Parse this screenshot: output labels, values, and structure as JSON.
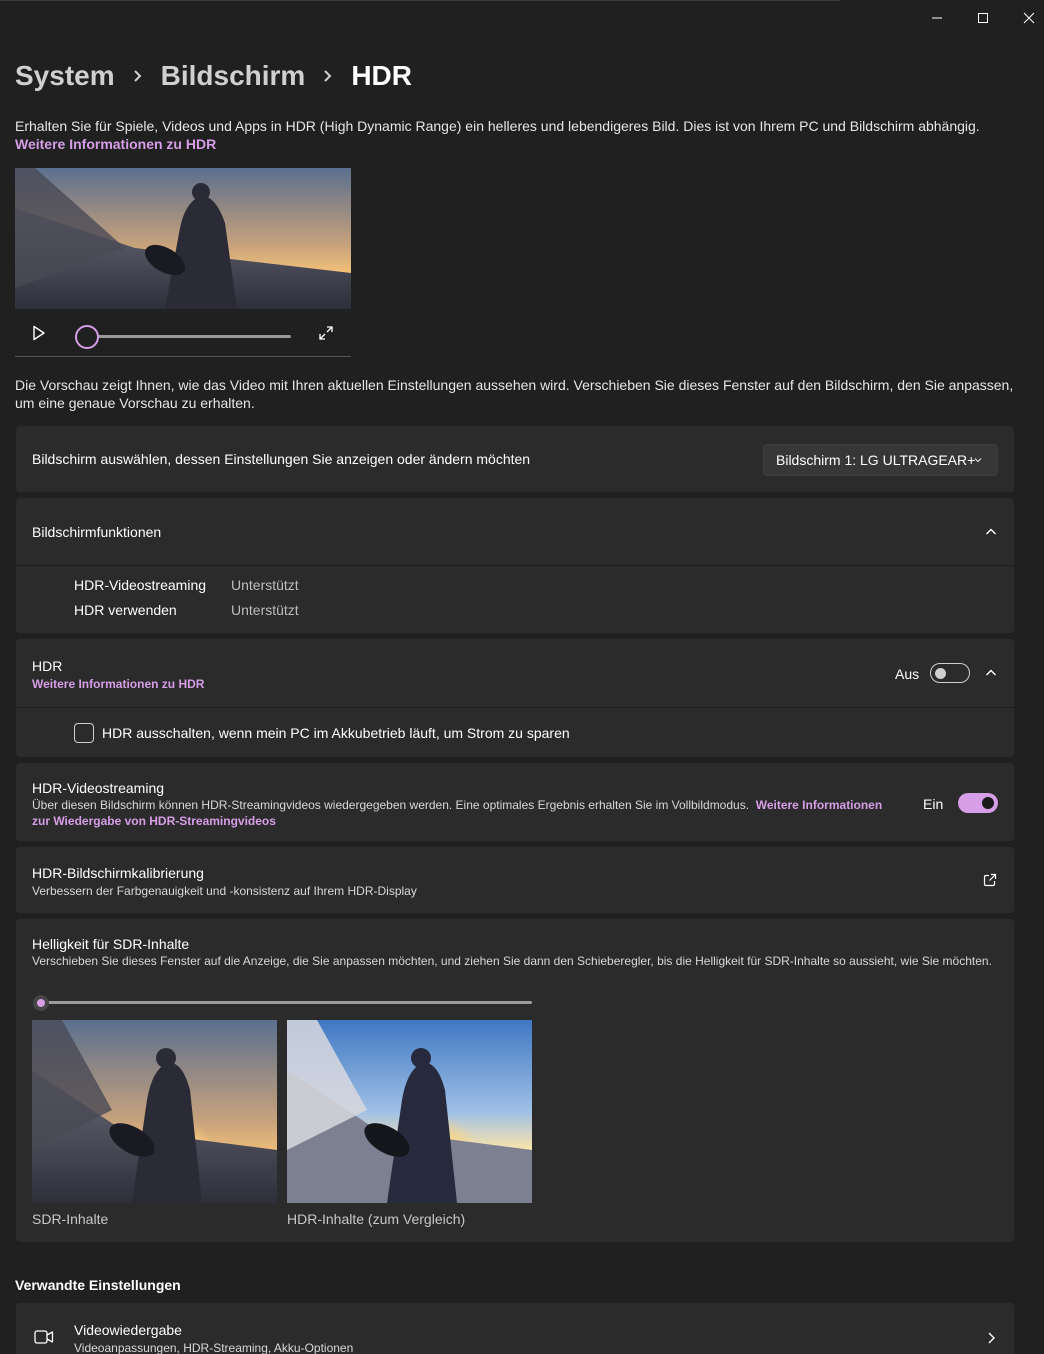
{
  "window": {
    "minimize_icon": "minimize-icon",
    "maximize_icon": "maximize-icon",
    "close_icon": "close-icon"
  },
  "breadcrumb": [
    "System",
    "Bildschirm",
    "HDR"
  ],
  "intro": {
    "text": "Erhalten Sie für Spiele, Videos und Apps in HDR (High Dynamic Range) ein helleres und lebendigeres Bild. Dies ist von Ihrem PC und Bildschirm abhängig.",
    "link": "Weitere Informationen zu HDR"
  },
  "video": {
    "play_icon": "play-icon",
    "fullscreen_icon": "fullscreen-icon",
    "progress": 0
  },
  "preview_note": "Die Vorschau zeigt Ihnen, wie das Video mit Ihren aktuellen Einstellungen aussehen wird. Verschieben Sie dieses Fenster auf den Bildschirm, den Sie anpassen, um eine genaue Vorschau zu erhalten.",
  "display_select": {
    "label": "Bildschirm auswählen, dessen Einstellungen Sie anzeigen oder ändern möchten",
    "value": "Bildschirm 1: LG ULTRAGEAR+"
  },
  "capabilities": {
    "title": "Bildschirmfunktionen",
    "rows": [
      {
        "name": "HDR-Videostreaming",
        "value": "Unterstützt"
      },
      {
        "name": "HDR verwenden",
        "value": "Unterstützt"
      }
    ]
  },
  "hdr": {
    "title": "HDR",
    "link": "Weitere Informationen zu HDR",
    "state": "Aus",
    "enabled": false,
    "battery_option": "HDR ausschalten, wenn mein PC im Akkubetrieb läuft, um Strom zu sparen",
    "battery_checked": false
  },
  "streaming": {
    "title": "HDR-Videostreaming",
    "desc": "Über diesen Bildschirm können HDR-Streamingvideos wiedergegeben werden. Eine optimales Ergebnis erhalten Sie im Vollbildmodus.",
    "link_a": "Weitere Informationen",
    "link_b": "zur Wiedergabe von HDR-Streamingvideos",
    "state": "Ein",
    "enabled": true
  },
  "calibration": {
    "title": "HDR-Bildschirmkalibrierung",
    "desc": "Verbessern der Farbgenauigkeit und -konsistenz auf Ihrem HDR-Display",
    "icon": "external-link-icon"
  },
  "sdr_brightness": {
    "title": "Helligkeit für SDR-Inhalte",
    "desc": "Verschieben Sie dieses Fenster auf die Anzeige, die Sie anpassen möchten, und ziehen Sie dann den Schieberegler, bis die Helligkeit für SDR-Inhalte so aussieht, wie Sie möchten.",
    "value": 0,
    "sdr_caption": "SDR-Inhalte",
    "hdr_caption": "HDR-Inhalte (zum Vergleich)"
  },
  "related": {
    "title": "Verwandte Einstellungen",
    "items": [
      {
        "title": "Videowiedergabe",
        "desc": "Videoanpassungen, HDR-Streaming, Akku-Optionen",
        "icon": "video-camera-icon"
      }
    ]
  },
  "colors": {
    "accent": "#d69ee6",
    "background": "#202020",
    "card": "#2b2b2b"
  }
}
